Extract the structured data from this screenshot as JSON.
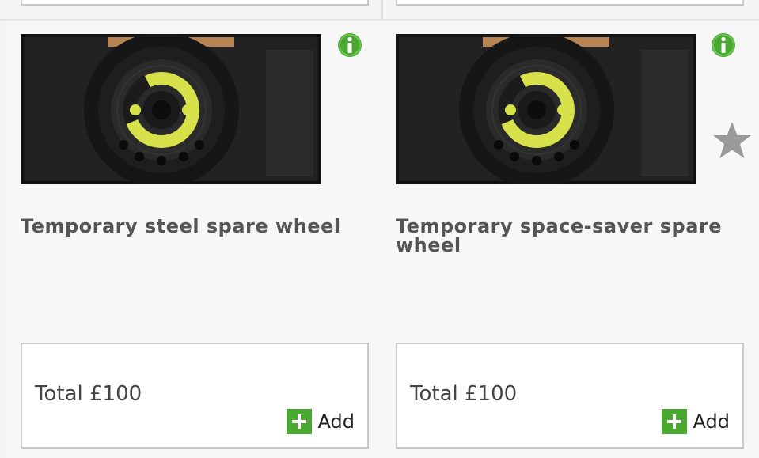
{
  "products": [
    {
      "title": "Temporary steel spare wheel",
      "image": "spare-wheel-photo",
      "info_icon": "info-icon",
      "total": "Total £100",
      "add_label": "Add"
    },
    {
      "title": "Temporary space-saver spare wheel",
      "image": "spare-wheel-photo",
      "info_icon": "info-icon",
      "favourite_icon": "star-icon",
      "total": "Total £100",
      "add_label": "Add"
    }
  ],
  "colors": {
    "accent_green": "#4aa832",
    "star_grey": "#9a9a9a",
    "title_text": "#555555"
  }
}
